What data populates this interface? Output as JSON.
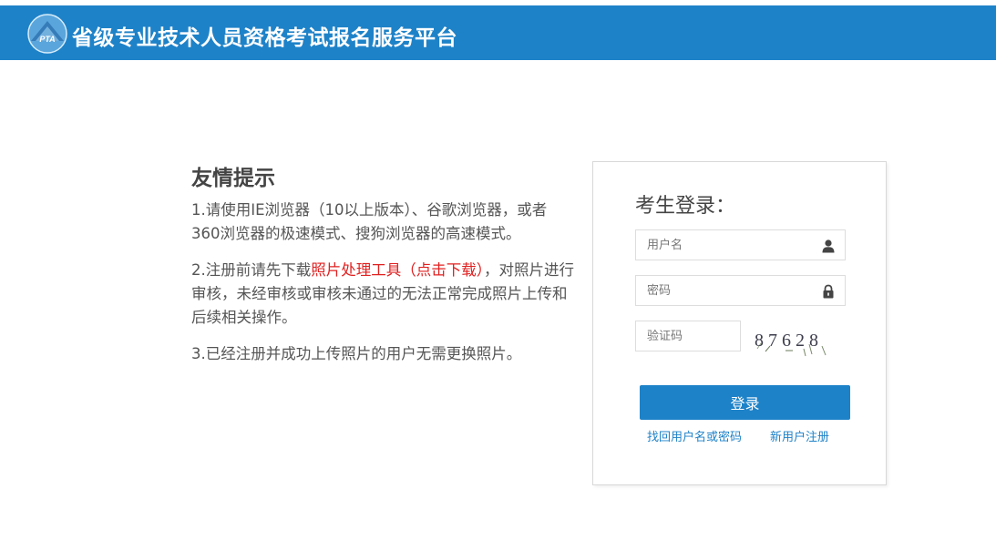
{
  "header": {
    "logo_text": "PTA",
    "title": "省级专业技术人员资格考试报名服务平台"
  },
  "tips": {
    "title": "友情提示",
    "items": [
      {
        "text": "1.请使用IE浏览器（10以上版本）、谷歌浏览器，或者360浏览器的极速模式、搜狗浏览器的高速模式。"
      },
      {
        "before": "2.注册前请先下载",
        "link": "照片处理工具（点击下载）",
        "after": "，对照片进行审核，未经审核或审核未通过的无法正常完成照片上传和后续相关操作。"
      },
      {
        "text": "3.已经注册并成功上传照片的用户无需更换照片。"
      }
    ]
  },
  "login": {
    "title": "考生登录：",
    "username_placeholder": "用户名",
    "password_placeholder": "密码",
    "captcha_placeholder": "验证码",
    "captcha_value": "87628",
    "submit_label": "登录",
    "forgot_label": "找回用户名或密码",
    "register_label": "新用户注册",
    "username_icon": "user-icon",
    "password_icon": "lock-icon"
  },
  "colors": {
    "brand": "#1e82c8",
    "link_highlight": "#e02020"
  }
}
